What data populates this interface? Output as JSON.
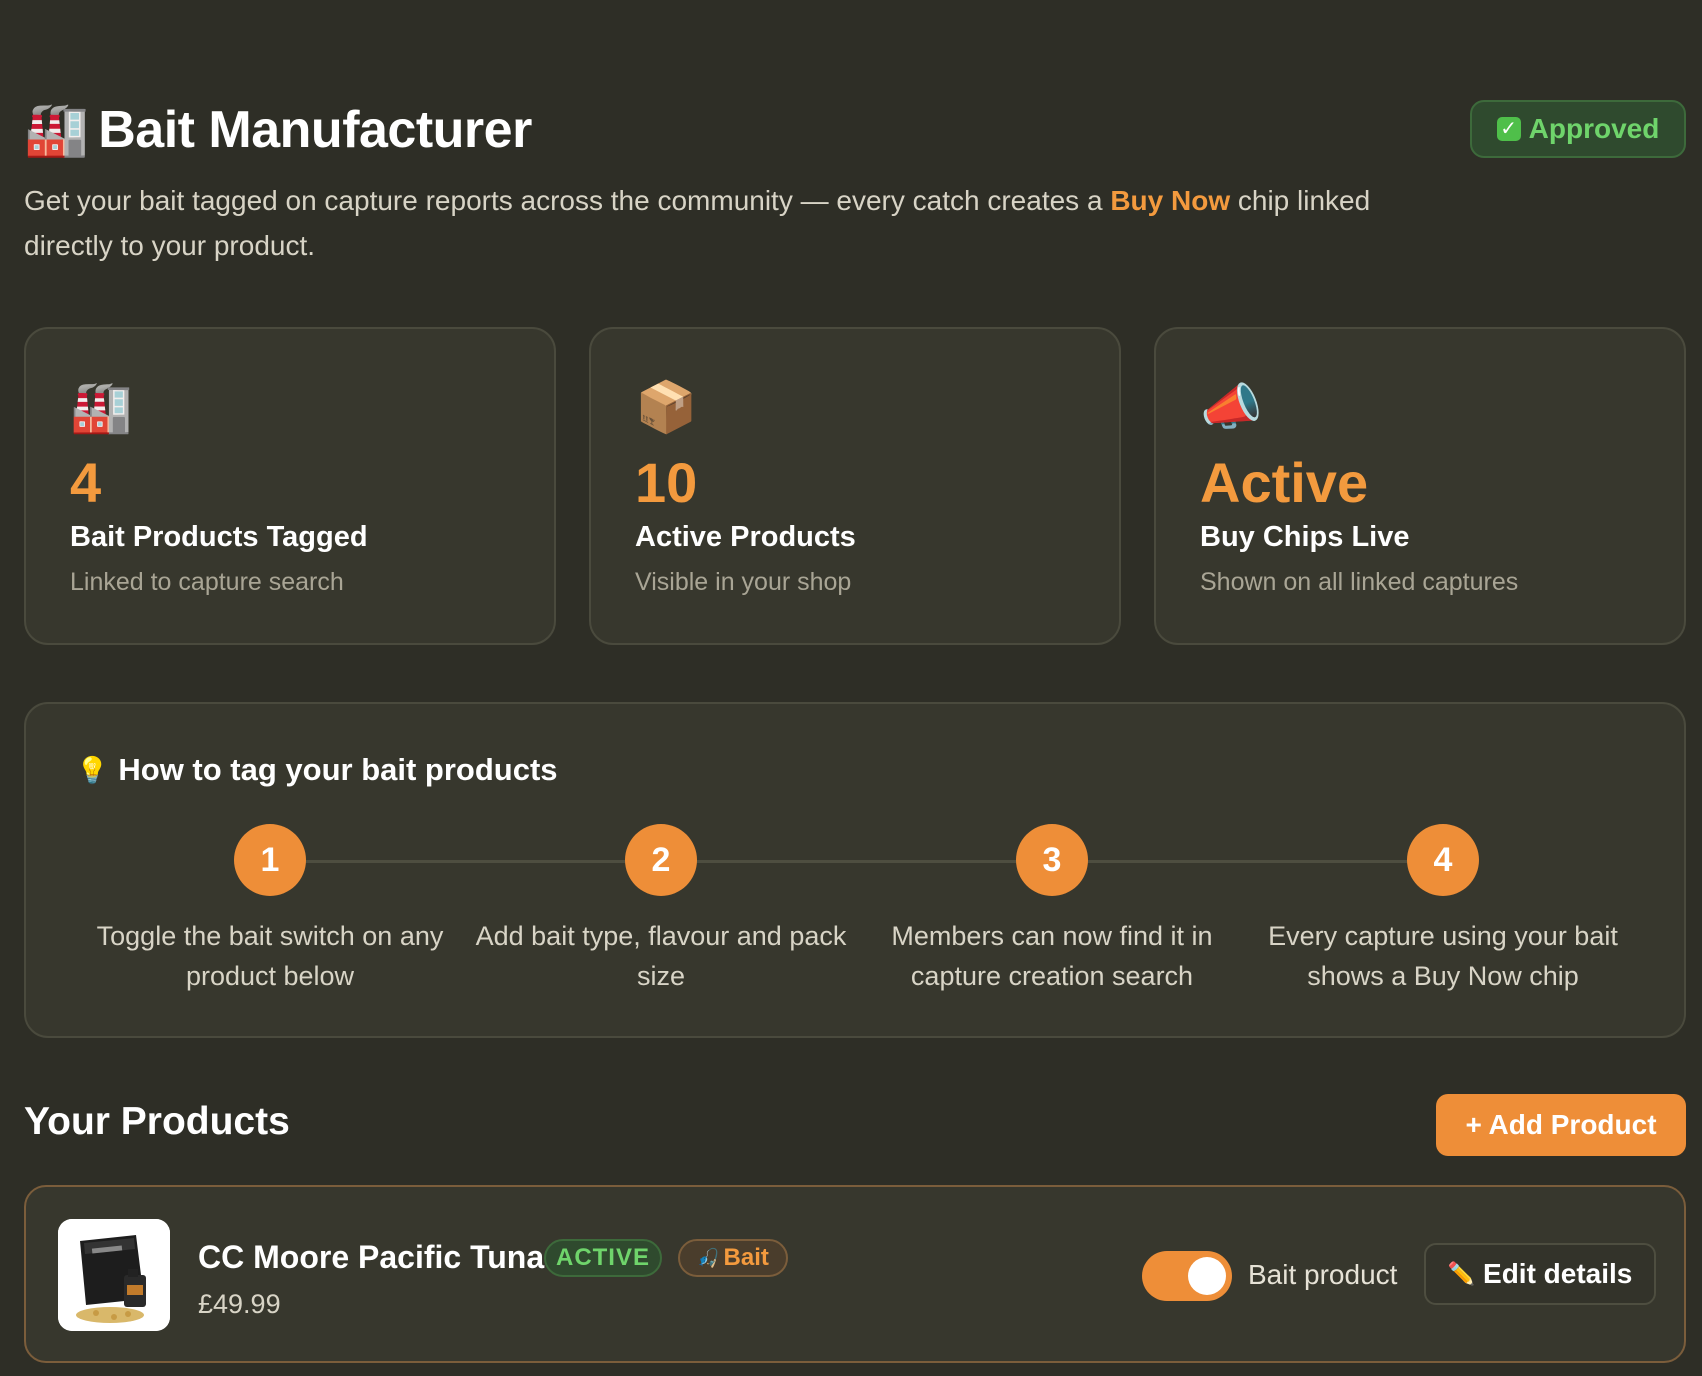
{
  "header": {
    "title": "Bait Manufacturer",
    "title_icon": "🏭",
    "status_badge": "Approved",
    "status_icon": "✓",
    "subtitle_before": "Get your bait tagged on capture reports across the community — every catch creates a ",
    "subtitle_highlight": "Buy Now",
    "subtitle_after": " chip linked directly to your product."
  },
  "stats": [
    {
      "icon": "🏭",
      "icon_name": "factory-icon",
      "value": "4",
      "label": "Bait Products Tagged",
      "sub": "Linked to capture search"
    },
    {
      "icon": "📦",
      "icon_name": "package-icon",
      "value": "10",
      "label": "Active Products",
      "sub": "Visible in your shop"
    },
    {
      "icon": "📣",
      "icon_name": "megaphone-icon",
      "value": "Active",
      "label": "Buy Chips Live",
      "sub": "Shown on all linked captures"
    }
  ],
  "howto": {
    "icon": "💡",
    "title": "How to tag your bait products",
    "steps": [
      {
        "num": "1",
        "text": "Toggle the bait switch on any product below"
      },
      {
        "num": "2",
        "text": "Add bait type, flavour and pack size"
      },
      {
        "num": "3",
        "text": "Members can now find it in capture creation search"
      },
      {
        "num": "4",
        "text": "Every capture using your bait shows a Buy Now chip"
      }
    ]
  },
  "products": {
    "title": "Your Products",
    "add_label": "+ Add Product",
    "items": [
      {
        "name": "CC Moore Pacific Tuna",
        "status": "ACTIVE",
        "bait_badge": "Bait",
        "bait_icon": "🎣",
        "price": "£49.99",
        "toggle_label": "Bait product",
        "toggle_on": true,
        "edit_icon": "✏️",
        "edit_label": "Edit details"
      }
    ]
  },
  "colors": {
    "background": "#2e2e26",
    "card": "#37372d",
    "accent": "#ee8e38",
    "success": "#6fd46b"
  }
}
